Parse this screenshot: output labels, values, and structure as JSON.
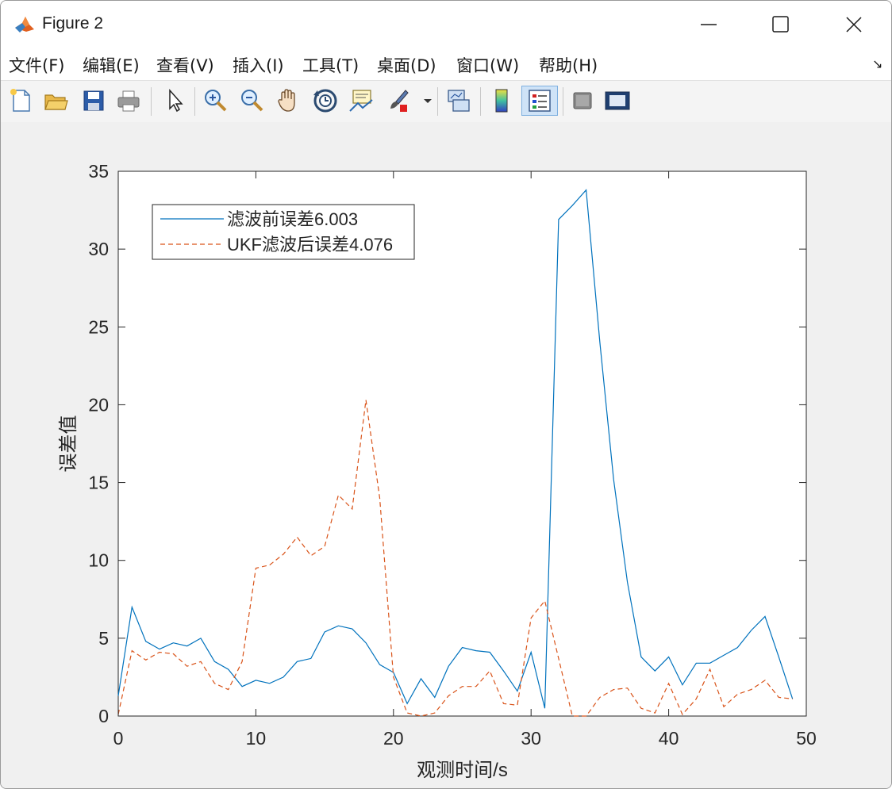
{
  "window": {
    "title": "Figure 2"
  },
  "menu": [
    "文件(F)",
    "编辑(E)",
    "查看(V)",
    "插入(I)",
    "工具(T)",
    "桌面(D)",
    "窗口(W)",
    "帮助(H)"
  ],
  "toolbar": [
    {
      "icon": "new-file-icon"
    },
    {
      "icon": "open-folder-icon"
    },
    {
      "icon": "save-icon"
    },
    {
      "icon": "print-icon"
    },
    {
      "icon": "pointer-icon"
    },
    {
      "icon": "zoom-in-icon"
    },
    {
      "icon": "zoom-out-icon"
    },
    {
      "icon": "pan-hand-icon"
    },
    {
      "icon": "rotate-3d-icon"
    },
    {
      "icon": "data-cursor-icon"
    },
    {
      "icon": "brush-icon"
    },
    {
      "icon": "link-plot-icon"
    },
    {
      "icon": "colorbar-icon"
    },
    {
      "icon": "legend-icon",
      "active": true
    },
    {
      "icon": "hide-plot-tools-icon"
    },
    {
      "icon": "show-plot-tools-icon"
    }
  ],
  "chart_data": {
    "type": "line",
    "xlabel": "观测时间/s",
    "ylabel": "误差值",
    "xlim": [
      0,
      50
    ],
    "ylim": [
      0,
      35
    ],
    "xticks": [
      0,
      10,
      20,
      30,
      40,
      50
    ],
    "yticks": [
      0,
      5,
      10,
      15,
      20,
      25,
      30,
      35
    ],
    "legend_position": "top-left",
    "series": [
      {
        "name": "滤波前误差6.003",
        "color": "#0072bd",
        "style": "solid",
        "x": [
          0,
          1,
          2,
          3,
          4,
          5,
          6,
          7,
          8,
          9,
          10,
          11,
          12,
          13,
          14,
          15,
          16,
          17,
          18,
          19,
          20,
          21,
          22,
          23,
          24,
          25,
          26,
          27,
          28,
          29,
          30,
          31,
          32,
          33,
          34,
          35,
          36,
          37,
          38,
          39,
          40,
          41,
          42,
          43,
          44,
          45,
          46,
          47,
          48,
          49
        ],
        "y": [
          1.3,
          7.0,
          4.8,
          4.3,
          4.7,
          4.5,
          5.0,
          3.5,
          3.0,
          1.9,
          2.3,
          2.1,
          2.5,
          3.5,
          3.7,
          5.4,
          5.8,
          5.6,
          4.7,
          3.3,
          2.8,
          0.8,
          2.4,
          1.2,
          3.2,
          4.4,
          4.2,
          4.1,
          2.9,
          1.6,
          4.1,
          0.5,
          31.9,
          32.8,
          33.8,
          24.0,
          15.2,
          8.6,
          3.8,
          2.9,
          3.8,
          2.0,
          3.4,
          3.4,
          3.9,
          4.4,
          5.5,
          6.4,
          3.8,
          1.1
        ]
      },
      {
        "name": "UKF滤波后误差4.076",
        "color": "#d95319",
        "style": "dashed",
        "x": [
          0,
          1,
          2,
          3,
          4,
          5,
          6,
          7,
          8,
          9,
          10,
          11,
          12,
          13,
          14,
          15,
          16,
          17,
          18,
          19,
          20,
          21,
          22,
          23,
          24,
          25,
          26,
          27,
          28,
          29,
          30,
          31,
          32,
          33,
          34,
          35,
          36,
          37,
          38,
          39,
          40,
          41,
          42,
          43,
          44,
          45,
          46,
          47,
          48,
          49
        ],
        "y": [
          0.1,
          4.2,
          3.6,
          4.1,
          4.0,
          3.2,
          3.5,
          2.1,
          1.7,
          3.5,
          9.5,
          9.7,
          10.4,
          11.5,
          10.3,
          10.9,
          14.2,
          13.3,
          20.3,
          14.0,
          2.5,
          0.2,
          0.0,
          0.2,
          1.3,
          1.9,
          1.9,
          2.9,
          0.8,
          0.7,
          6.3,
          7.4,
          3.7,
          0.0,
          0.0,
          1.2,
          1.7,
          1.8,
          0.5,
          0.2,
          2.1,
          0.1,
          1.1,
          3.0,
          0.6,
          1.4,
          1.7,
          2.3,
          1.2,
          1.1
        ]
      }
    ]
  }
}
